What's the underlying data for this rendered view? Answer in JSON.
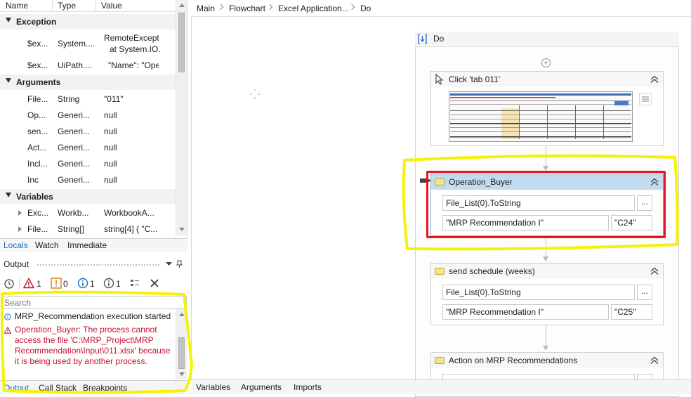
{
  "locals": {
    "columns": [
      "Name",
      "Type",
      "Value"
    ],
    "groups": {
      "exception": "Exception",
      "arguments": "Arguments",
      "variables": "Variables"
    },
    "exception_rows": [
      {
        "name": "$ex...",
        "type": "System....",
        "value": "RemoteExcepti",
        "value2": "at System.IO."
      },
      {
        "name": "$ex...",
        "type": "UiPath....",
        "value": "\"Name\": \"Ope"
      }
    ],
    "argument_rows": [
      {
        "name": "File...",
        "type": "String",
        "value": "\"011\""
      },
      {
        "name": "Op...",
        "type": "Generi...",
        "value": "null"
      },
      {
        "name": "sen...",
        "type": "Generi...",
        "value": "null"
      },
      {
        "name": "Act...",
        "type": "Generi...",
        "value": "null"
      },
      {
        "name": "Incl...",
        "type": "Generi...",
        "value": "null"
      },
      {
        "name": "Inc",
        "type": "Generi...",
        "value": "null"
      }
    ],
    "variable_rows": [
      {
        "name": "Exc...",
        "type": "Workb...",
        "value": "WorkbookA..."
      },
      {
        "name": "File...",
        "type": "String[]",
        "value": "string[4] { \"C..."
      }
    ],
    "tabs": [
      "Locals",
      "Watch",
      "Immediate"
    ]
  },
  "output": {
    "title": "Output",
    "counts": {
      "errors": "1",
      "warnings": "0",
      "info": "1",
      "trace": "1"
    },
    "search_placeholder": "Search",
    "messages": [
      {
        "kind": "info",
        "text": "MRP_Recommendation execution started"
      },
      {
        "kind": "error",
        "text": "Operation_Buyer: The process cannot access the file 'C:\\MRP_Project\\MRP Recommendation\\Input\\011.xlsx' because it is being used by another process."
      }
    ],
    "tabs": [
      "Output",
      "Call Stack",
      "Breakpoints"
    ]
  },
  "breadcrumb": [
    "Main",
    "Flowchart",
    "Excel Application...",
    "Do"
  ],
  "designer": {
    "sequence_title": "Do",
    "activities": [
      {
        "title": "Click 'tab  011'"
      },
      {
        "title": "Operation_Buyer",
        "field1": "File_List(0).ToString",
        "field2": "\"MRP Recommendation I\"",
        "field3": "\"C24\""
      },
      {
        "title": "send schedule (weeks)",
        "field1": "File_List(0).ToString",
        "field2": "\"MRP Recommendation I\"",
        "field3": "\"C25\""
      },
      {
        "title": "Action on MRP Recommendations"
      }
    ],
    "dots_label": "...",
    "bottom_tabs": [
      "Variables",
      "Arguments",
      "Imports"
    ]
  },
  "colors": {
    "selected_header": "#c3dbef",
    "error_text": "#c8102e",
    "highlight_red": "#e8141c",
    "annotation_yellow": "#f5f20a",
    "link_blue": "#1e6fc0"
  }
}
